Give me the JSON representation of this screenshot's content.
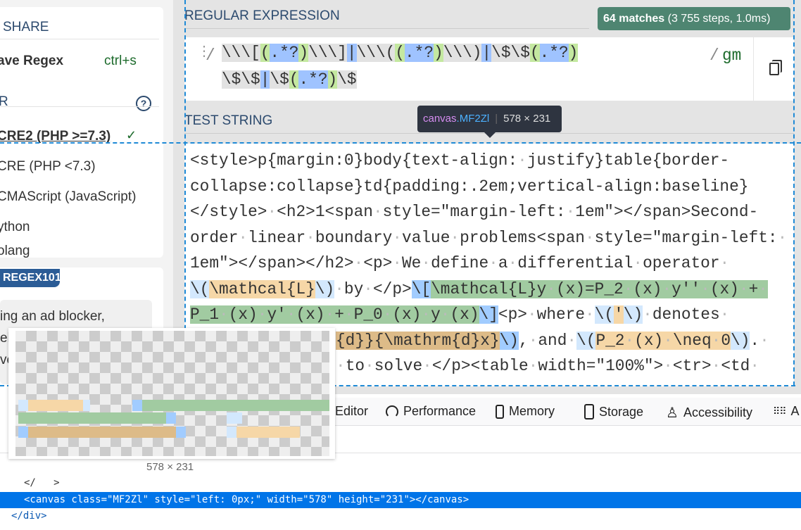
{
  "sidebar": {
    "share_label": "SHARE",
    "save_label": "ave Regex",
    "save_shortcut": "ctrl+s",
    "flavor_header": "R",
    "help_icon": "question-circle-icon",
    "flavors": [
      "CRE2 (PHP >=7.3)",
      "CRE (PHP <7.3)",
      "CMAScript (JavaScript)",
      "ython",
      "olang"
    ],
    "selected_flavor_check": "✓",
    "sponsor_badge": "REGEX101",
    "sponsor_text": [
      "ing an ad blocker,",
      "el",
      "ve"
    ]
  },
  "regex": {
    "header": "REGULAR EXPRESSION",
    "match_count": "64 matches",
    "match_detail": " (3 755 steps, 1.0ms)",
    "delimiter_open": "/",
    "delimiter_close": "/",
    "flags": "gm",
    "line1": [
      [
        "g",
        "\\\\\\["
      ],
      [
        "rg",
        "("
      ],
      [
        "rb",
        ".*?"
      ],
      [
        "rg",
        ")"
      ],
      [
        "g",
        "\\\\\\]"
      ],
      [
        "rb",
        "|"
      ],
      [
        "g",
        "\\\\\\("
      ],
      [
        "rg",
        "("
      ],
      [
        "rb",
        ".*?"
      ],
      [
        "rg",
        ")"
      ],
      [
        "g",
        "\\\\\\)"
      ],
      [
        "rb",
        "|"
      ],
      [
        "g",
        "\\$\\$"
      ],
      [
        "rg",
        "("
      ],
      [
        "rb",
        ".*?"
      ],
      [
        "rg",
        ")"
      ]
    ],
    "line2": [
      [
        "g",
        "\\$\\$"
      ],
      [
        "rb",
        "|"
      ],
      [
        "g",
        "\\$"
      ],
      [
        "rg",
        "("
      ],
      [
        "rb",
        ".*?"
      ],
      [
        "rg",
        ")"
      ],
      [
        "g",
        "\\$"
      ]
    ]
  },
  "test_string": {
    "header": "TEST STRING",
    "lines": [
      [
        [
          "",
          "<style>p{margin:0}body{text-align:•justify}table{border-"
        ]
      ],
      [
        [
          "",
          "collapse:collapse}td{padding:.2em;vertical-align:baseline}"
        ]
      ],
      [
        [
          "",
          "</style>•<h2>1<span•style=\"margin-left:•1em\"></span>Second-"
        ]
      ],
      [
        [
          "",
          "order•linear•boundary•value•problems<span•style=\"margin-left:•"
        ]
      ],
      [
        [
          "",
          "1em\"></span></h2>•<p>•We•define•a•differential•operator•"
        ]
      ],
      [
        [
          "lb",
          "\\("
        ],
        [
          "or",
          "\\mathcal{L}"
        ],
        [
          "lb",
          "\\)"
        ],
        [
          "",
          "•by•</p>"
        ],
        [
          "db",
          "\\["
        ],
        [
          "gr",
          "\\mathcal{L}y•(x)=P_2•(x)•y''•(x)•+•"
        ]
      ],
      [
        [
          "gr",
          "P_1•(x)•y'•(x)•+•P_0•(x)•y•(x)"
        ],
        [
          "db",
          "\\]"
        ],
        [
          "",
          "<p>•where•"
        ],
        [
          "lb",
          "\\("
        ],
        [
          "or",
          "'"
        ],
        [
          "lb",
          "\\)"
        ],
        [
          "",
          "•denotes•"
        ]
      ],
      [
        [
          "br",
          "{d}}{\\mathrm{d}x}"
        ],
        [
          "db",
          "\\)"
        ],
        [
          "",
          ",•and•"
        ],
        [
          "lb",
          "\\("
        ],
        [
          "or",
          "P_2•(x)•\\neq•0"
        ],
        [
          "lb",
          "\\)"
        ],
        [
          "",
          ".•"
        ]
      ],
      [
        [
          "",
          "•to•solve•</p><table•width=\"100%\">•<tr>•<td•"
        ]
      ]
    ]
  },
  "tooltip": {
    "tag": "canvas",
    "cls": ".MF2Zl",
    "size": "578 × 231"
  },
  "devtools": {
    "tabs": [
      {
        "label": "Editor",
        "icon": ""
      },
      {
        "label": "Performance",
        "icon": "gauge-icon"
      },
      {
        "label": "Memory",
        "icon": "chip-icon"
      },
      {
        "label": "Storage",
        "icon": "database-icon"
      },
      {
        "label": "Accessibility",
        "icon": "person-icon"
      },
      {
        "label": "A",
        "icon": "grid-icon"
      }
    ],
    "preview_size": "578 × 231",
    "markup": [
      "</",
      ">",
      "<canvas class=\"MF2Zl\" style=\"left: 0px;\" width=\"578\" height=\"231\"></canvas>",
      "</div>"
    ]
  },
  "colors": {
    "match_badge": "#4e8571",
    "group_green": "#a1cba1",
    "group_orange": "#f6d7a7",
    "selection": "#0074e8"
  }
}
